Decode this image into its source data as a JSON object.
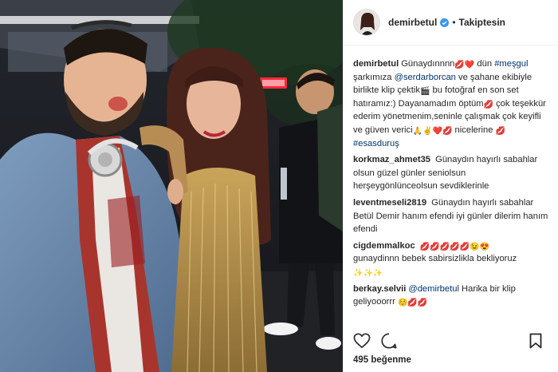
{
  "photo": {
    "description_icon": "photo-content",
    "neon_sign_color": "#ff2a3a"
  },
  "header": {
    "username": "demirbetul",
    "separator": "•",
    "follow_state": "Takiptesin",
    "verified_icon": "verified-badge-icon"
  },
  "caption": {
    "username": "demirbetul",
    "line1": "Günaydınnnn",
    "line1_emoji": "💋❤️",
    "line1_rest": " dün",
    "hashtag1": "#meşgul",
    "text2": " şarkımıza ",
    "mention1": "@serdarborcan",
    "text3": " ve şahane ekibiyle birlikte klip çektik",
    "clapper_emoji": "🎬",
    "text4": " bu fotoğraf en son set hatıramız:) Dayanamadım öptüm",
    "kiss_emoji": "💋",
    "text5": " çok teşekkür ederim yönetmenim,seninle çalışmak çok keyifli ve güven verici",
    "emoji_row": "🙏✌️❤️💋",
    "text6": " nicelerine ",
    "emoji_kiss2": "💋",
    "hashtag2": "#esasduruş"
  },
  "comments": [
    {
      "username": "korkmaz_ahmet35",
      "text": " Günaydın hayırlı sabahlar olsun güzel günler seniolsun herşeygönlünceolsun sevdiklerinle"
    },
    {
      "username": "leventmeseli2819",
      "text": " Günaydın hayırlı sabahlar Betül Demir hanım efendi iyi günler dilerim hanım efendi"
    },
    {
      "username": "cigdemmalkoc",
      "text": " ",
      "emoji": "💋💋💋💋💋😉😍",
      "line2": "gunaydinnn bebek sabirsizlikla bekliyoruz",
      "emoji2": "✨✨✨"
    },
    {
      "username": "berkay.selvii",
      "mention": "@demirbetul",
      "text": " Harika bir klip geliyooorrr ",
      "emoji": "☺️💋💋"
    }
  ],
  "actions": {
    "like_icon": "heart-icon",
    "comment_icon": "comment-icon",
    "save_icon": "bookmark-icon"
  },
  "likes": {
    "label": "495 beğenme"
  }
}
